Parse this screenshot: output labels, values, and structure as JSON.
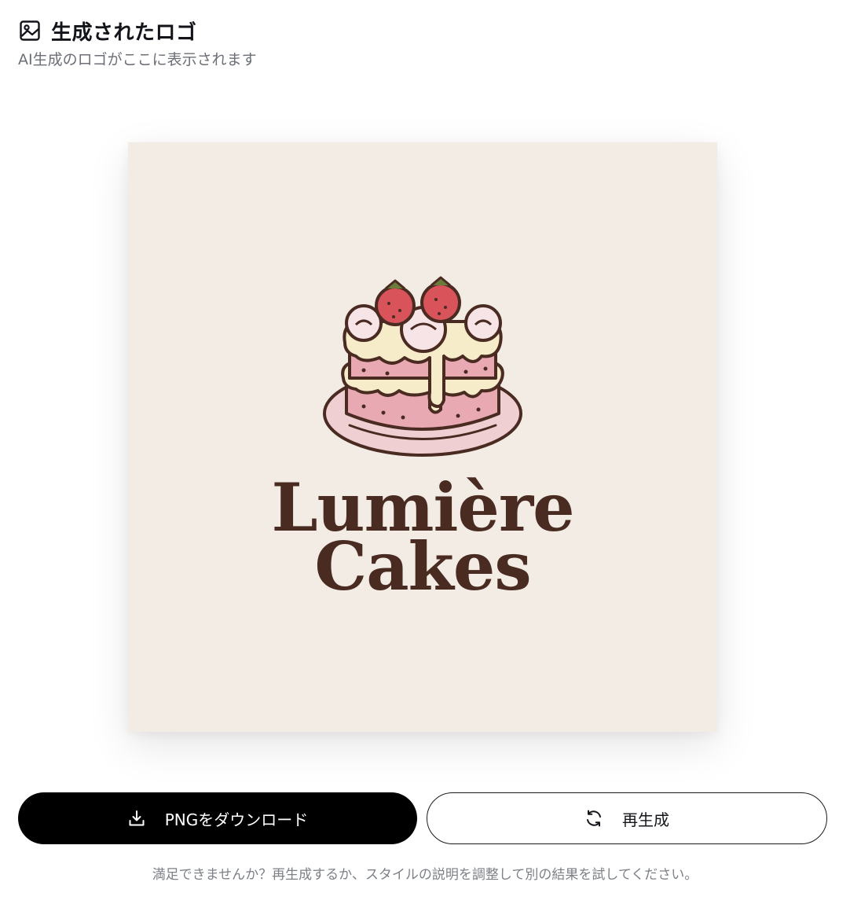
{
  "header": {
    "title": "生成されたロゴ",
    "subtitle": "AI生成のロゴがここに表示されます",
    "icon": "image-icon"
  },
  "logo": {
    "line1": "Lumière",
    "line2": "Cakes",
    "image": "cake-illustration",
    "background_color": "#f2ece5",
    "text_color": "#4a2b22"
  },
  "actions": {
    "download_label": "PNGをダウンロード",
    "download_icon": "download-icon",
    "regenerate_label": "再生成",
    "regenerate_icon": "refresh-icon"
  },
  "hint": "満足できませんか？再生成するか、スタイルの説明を調整して別の結果を試してください。"
}
